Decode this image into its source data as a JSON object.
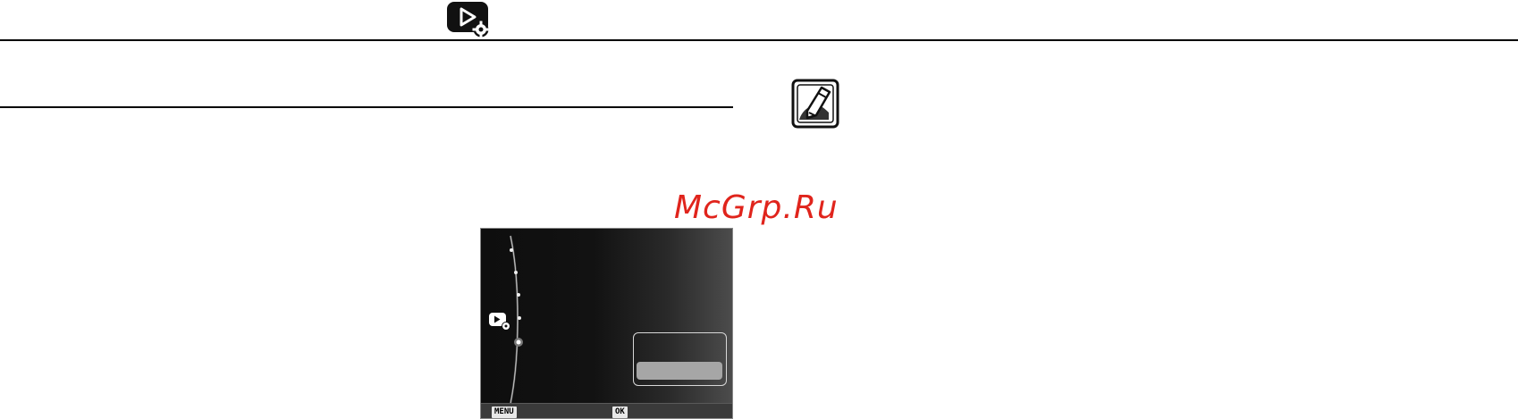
{
  "header": {
    "icon": "playback-settings-icon"
  },
  "note": {
    "icon": "note-pencil-icon"
  },
  "watermark": {
    "text": "McGrp.Ru",
    "color": "#e0241c"
  },
  "lcd": {
    "mode_icon": "playback-settings-icon",
    "bottom_bar": {
      "menu_key": "MENU",
      "ok_key": "OK"
    },
    "option_box": {
      "selected_index": 1,
      "option_count": 2
    }
  }
}
